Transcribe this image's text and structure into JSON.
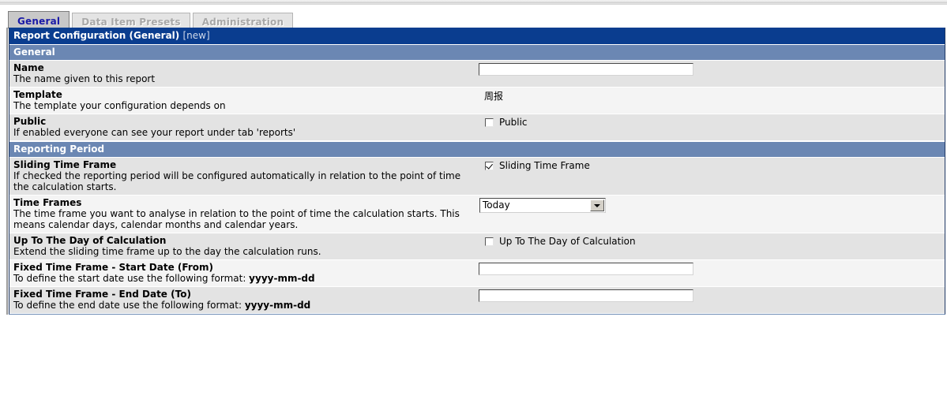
{
  "tabs": [
    {
      "label": "General",
      "active": true
    },
    {
      "label": "Data Item Presets",
      "active": false
    },
    {
      "label": "Administration",
      "active": false
    }
  ],
  "titlebar": {
    "title": "Report Configuration (General)",
    "tag": "[new]"
  },
  "colors": {
    "titlebar_bg": "#0a3d8f",
    "section_bg": "#6b87b3",
    "active_tab_text": "#1a1aa8",
    "row_shade_a": "#e3e3e3",
    "row_shade_b": "#f4f4f4"
  },
  "sections": [
    {
      "header": "General",
      "rows": [
        {
          "title": "Name",
          "desc": "The name given to this report",
          "control": "text",
          "value": "",
          "placeholder": ""
        },
        {
          "title": "Template",
          "desc": "The template your configuration depends on",
          "control": "static",
          "value": "周报"
        },
        {
          "title": "Public",
          "desc": "If enabled everyone can see your report under tab 'reports'",
          "control": "checkbox",
          "checkbox_label": "Public",
          "checked": false
        }
      ]
    },
    {
      "header": "Reporting Period",
      "rows": [
        {
          "title": "Sliding Time Frame",
          "desc": "If checked the reporting period will be configured automatically in relation to the point of time the calculation starts.",
          "control": "checkbox",
          "checkbox_label": "Sliding Time Frame",
          "checked": true
        },
        {
          "title": "Time Frames",
          "desc": "The time frame you want to analyse in relation to the point of time the calculation starts. This means calendar days, calendar months and calendar years.",
          "control": "select",
          "value": "Today",
          "options": [
            "Today"
          ]
        },
        {
          "title": "Up To The Day of Calculation",
          "desc": "Extend the sliding time frame up to the day the calculation runs.",
          "control": "checkbox",
          "checkbox_label": "Up To The Day of Calculation",
          "checked": false
        },
        {
          "title": "Fixed Time Frame - Start Date (From)",
          "desc_prefix": "To define the start date use the following format: ",
          "desc_bold": "yyyy-mm-dd",
          "control": "text",
          "value": "",
          "placeholder": ""
        },
        {
          "title": "Fixed Time Frame - End Date (To)",
          "desc_prefix": "To define the end date use the following format: ",
          "desc_bold": "yyyy-mm-dd",
          "control": "text",
          "value": "",
          "placeholder": ""
        }
      ]
    }
  ]
}
